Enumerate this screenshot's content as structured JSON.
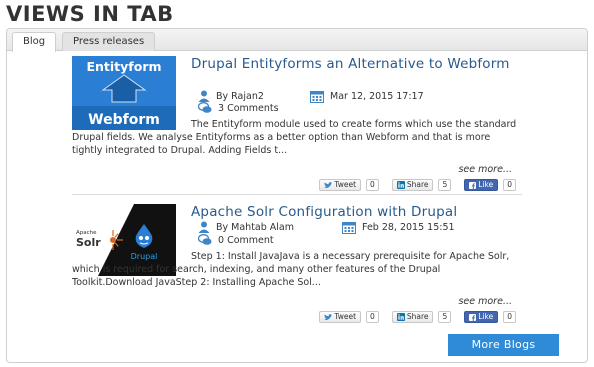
{
  "page_title": "VIEWS IN TAB",
  "tabs": [
    {
      "label": "Blog",
      "active": true
    },
    {
      "label": "Press releases",
      "active": false
    }
  ],
  "posts": [
    {
      "title": "Drupal Entityforms an Alternative to Webform",
      "author": "By Rajan2",
      "date": "Mar 12, 2015 17:17",
      "comments": "3 Comments",
      "excerpt": "The Entityform module used to create forms which use the standard Drupal fields. We analyse Entityforms as a better option than Webform and that is more tightly integrated to Drupal. Adding Fields t...",
      "see_more": "see more...",
      "thumb": {
        "top_text": "Entityform",
        "bottom_text": "Webform"
      },
      "share": {
        "tweet_label": "Tweet",
        "tweet_count": "0",
        "share_label": "Share",
        "share_count": "5",
        "like_label": "Like",
        "like_count": "0"
      }
    },
    {
      "title": "Apache Solr Configuration with Drupal",
      "author": "By Mahtab Alam",
      "date": "Feb 28, 2015 15:51",
      "comments": "0 Comment",
      "excerpt": "Step 1: Install JavaJava is a necessary prerequisite for Apache Solr, which is required for search, indexing, and many other features of the Drupal Toolkit.Download JavaStep 2: Installing Apache Sol...",
      "see_more": "see more...",
      "thumb": {
        "apache_text": "Apache",
        "solr_text": "Solr",
        "drupal_text": "Drupal"
      },
      "share": {
        "tweet_label": "Tweet",
        "tweet_count": "0",
        "share_label": "Share",
        "share_count": "5",
        "like_label": "Like",
        "like_count": "0"
      }
    }
  ],
  "more_blogs_label": "More Blogs",
  "colors": {
    "title_link": "#2a5a8c",
    "button": "#2f8ad8",
    "thumb_blue": "#2a7fd4",
    "icon_blue": "#3f86c6"
  }
}
